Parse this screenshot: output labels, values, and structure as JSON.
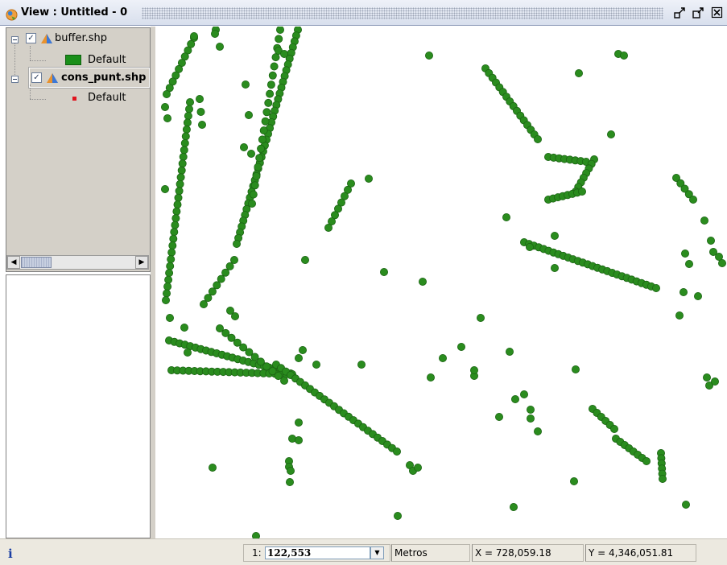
{
  "window": {
    "title": "View : Untitled - 0",
    "icons": [
      "app-globe-icon",
      "restore-icon",
      "maximize-icon",
      "close-icon"
    ]
  },
  "toc": {
    "layers": [
      {
        "name": "buffer.shp",
        "checked": true,
        "bold": false,
        "legend_label": "Default",
        "legend_color": "#1a8f1a"
      },
      {
        "name": "cons_punt.shp",
        "checked": true,
        "bold": true,
        "legend_label": "Default",
        "legend_color": "#e0141e"
      }
    ]
  },
  "statusbar": {
    "info_icon": "i",
    "scale_prefix": "1:",
    "scale_value": "122,553",
    "units": "Metros",
    "x_coord": "X = 728,059.18",
    "y_coord": "Y = 4,346,051.81"
  },
  "map": {
    "point_color": "#2a8c1e",
    "point_outline": "#1c6414"
  }
}
